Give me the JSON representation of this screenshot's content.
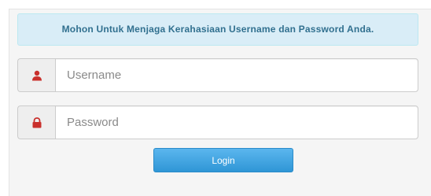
{
  "alert": {
    "message": "Mohon Untuk Menjaga Kerahasiaan Username dan Password Anda."
  },
  "username": {
    "icon": "user-icon",
    "placeholder": "Username",
    "value": ""
  },
  "password": {
    "icon": "lock-icon",
    "placeholder": "Password",
    "value": ""
  },
  "login": {
    "label": "Login"
  },
  "colors": {
    "alert_bg": "#d9edf7",
    "alert_text": "#31708f",
    "icon": "#c9302c",
    "button": "#2f96d6"
  }
}
